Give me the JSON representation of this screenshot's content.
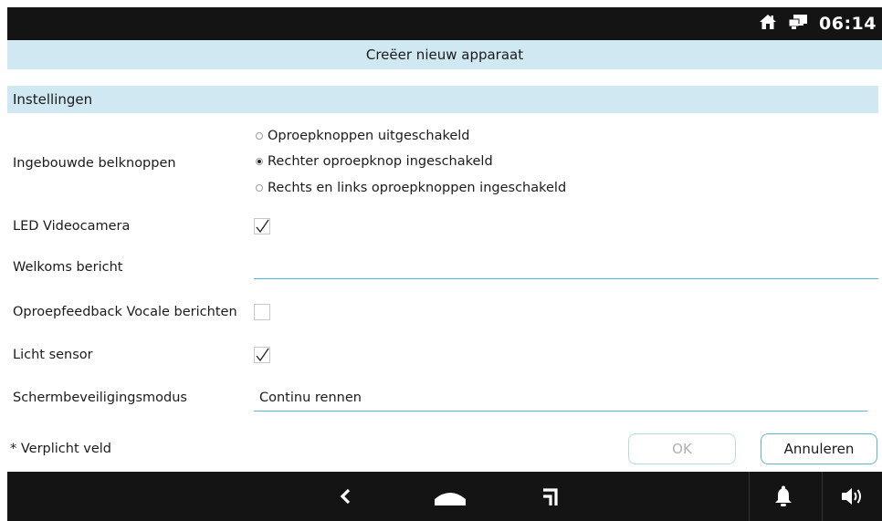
{
  "status_bar": {
    "time": "06:14",
    "icons": [
      "home-icon",
      "network-display-icon"
    ]
  },
  "title_bar": {
    "title": "Creëer nieuw apparaat"
  },
  "section": {
    "title": "Instellingen"
  },
  "settings": {
    "builtin_buttons": {
      "label": "Ingebouwde belknoppen",
      "options": [
        {
          "label": "Oproepknoppen uitgeschakeld",
          "selected": false
        },
        {
          "label": "Rechter oproepknop ingeschakeld",
          "selected": true
        },
        {
          "label": "Rechts en links oproepknoppen ingeschakeld",
          "selected": false
        }
      ]
    },
    "led_camera": {
      "label": "LED Videocamera",
      "checked": true
    },
    "welcome_message": {
      "label": "Welkoms bericht",
      "value": ""
    },
    "call_feedback": {
      "label": "Oproepfeedback Vocale berichten",
      "checked": false
    },
    "light_sensor": {
      "label": "Licht sensor",
      "checked": true
    },
    "screensaver": {
      "label": "Schermbeveiligingsmodus",
      "value": "Continu rennen"
    }
  },
  "footer": {
    "required_note": "* Verplicht veld",
    "ok_label": "OK",
    "cancel_label": "Annuleren"
  },
  "nav_bar": {
    "items": [
      "back-icon",
      "home-icon",
      "recent-apps-icon",
      "bell-icon",
      "volume-icon"
    ]
  },
  "colors": {
    "accent_bg": "#cfe8f2",
    "accent_line": "#4cb8d8",
    "bar_bg": "#141414"
  }
}
